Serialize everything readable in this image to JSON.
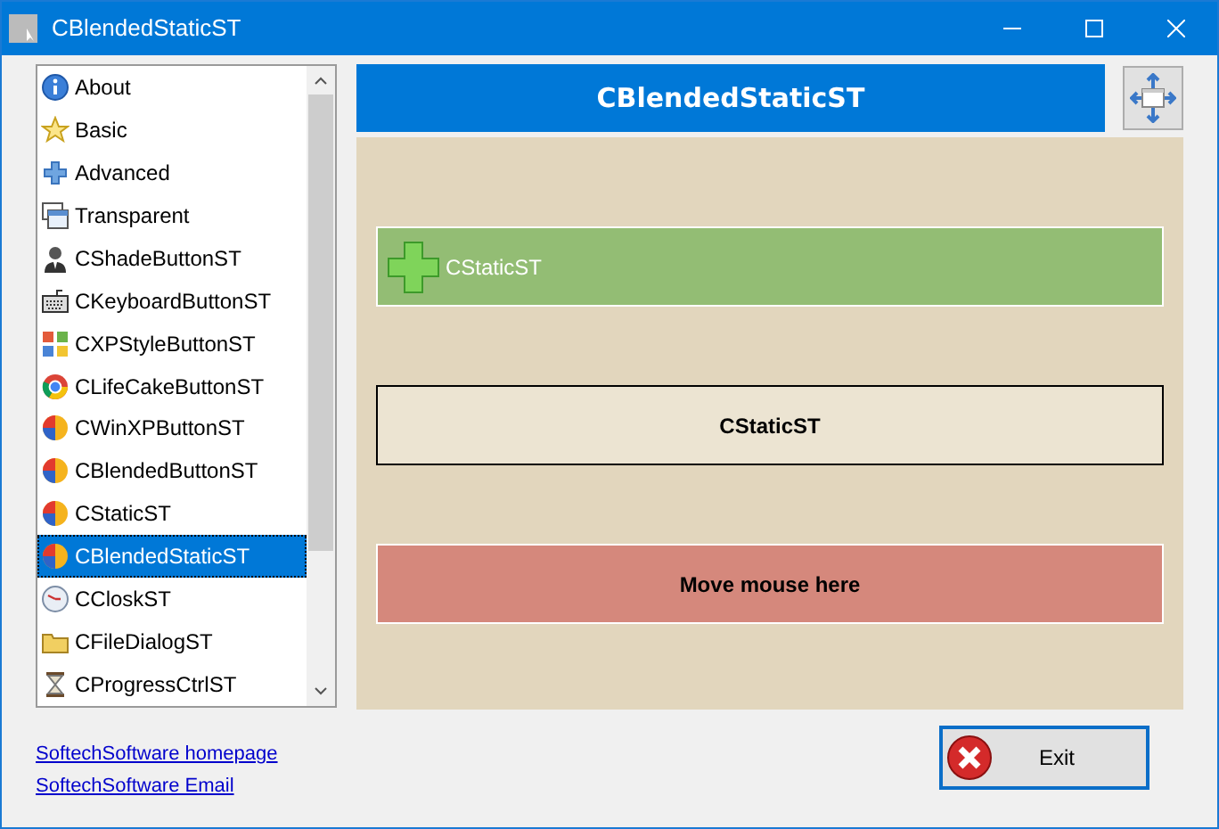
{
  "window": {
    "title": "CBlendedStaticST"
  },
  "list": {
    "items": [
      {
        "label": "About",
        "kind": "info",
        "selected": false
      },
      {
        "label": "Basic",
        "kind": "star",
        "selected": false
      },
      {
        "label": "Advanced",
        "kind": "plus",
        "selected": false
      },
      {
        "label": "Transparent",
        "kind": "windows",
        "selected": false
      },
      {
        "label": "CShadeButtonST",
        "kind": "person",
        "selected": false
      },
      {
        "label": "CKeyboardButtonST",
        "kind": "keyboard",
        "selected": false
      },
      {
        "label": "CXPStyleButtonST",
        "kind": "tiles",
        "selected": false
      },
      {
        "label": "CLifeCakeButtonST",
        "kind": "ring",
        "selected": false
      },
      {
        "label": "CWinXPButtonST",
        "kind": "ball",
        "selected": false
      },
      {
        "label": "CBlendedButtonST",
        "kind": "ball",
        "selected": false
      },
      {
        "label": "CStaticST",
        "kind": "ball",
        "selected": false
      },
      {
        "label": "CBlendedStaticST",
        "kind": "ball",
        "selected": true
      },
      {
        "label": "CCloskST",
        "kind": "clock",
        "selected": false
      },
      {
        "label": "CFileDialogST",
        "kind": "folder",
        "selected": false
      },
      {
        "label": "CProgressCtrlST",
        "kind": "hourglass",
        "selected": false
      }
    ]
  },
  "header": {
    "title": "CBlendedStaticST"
  },
  "statics": [
    {
      "kind": "green",
      "label": "CStaticST"
    },
    {
      "kind": "framed",
      "label": "CStaticST"
    },
    {
      "kind": "red",
      "label": "Move mouse here"
    }
  ],
  "links": [
    "SoftechSoftware homepage",
    "SoftechSoftware Email"
  ],
  "exit_button": {
    "label": "Exit"
  }
}
